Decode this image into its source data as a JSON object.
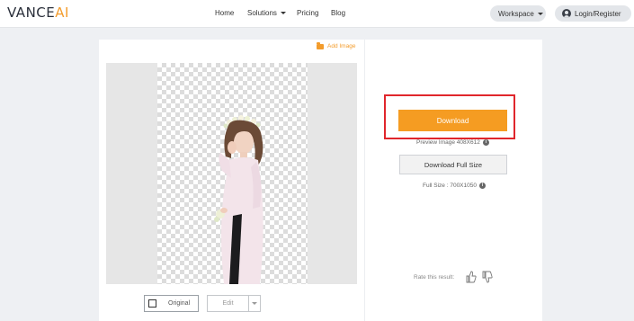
{
  "header": {
    "logo_main": "VANCE",
    "logo_accent": "AI",
    "nav": {
      "home": "Home",
      "solutions": "Solutions",
      "pricing": "Pricing",
      "blog": "Blog"
    },
    "workspace": "Workspace",
    "login": "Login/Register"
  },
  "editor": {
    "add_image": "Add Image",
    "original_label": "Original",
    "edit_label": "Edit"
  },
  "result": {
    "download_label": "Download",
    "preview_info": "Preview Image 408X612",
    "download_full_label": "Download Full Size",
    "full_info": "Full Size : 700X1050",
    "rate_label": "Rate this result:"
  },
  "colors": {
    "accent": "#f59c22",
    "highlight": "#e0262c"
  }
}
